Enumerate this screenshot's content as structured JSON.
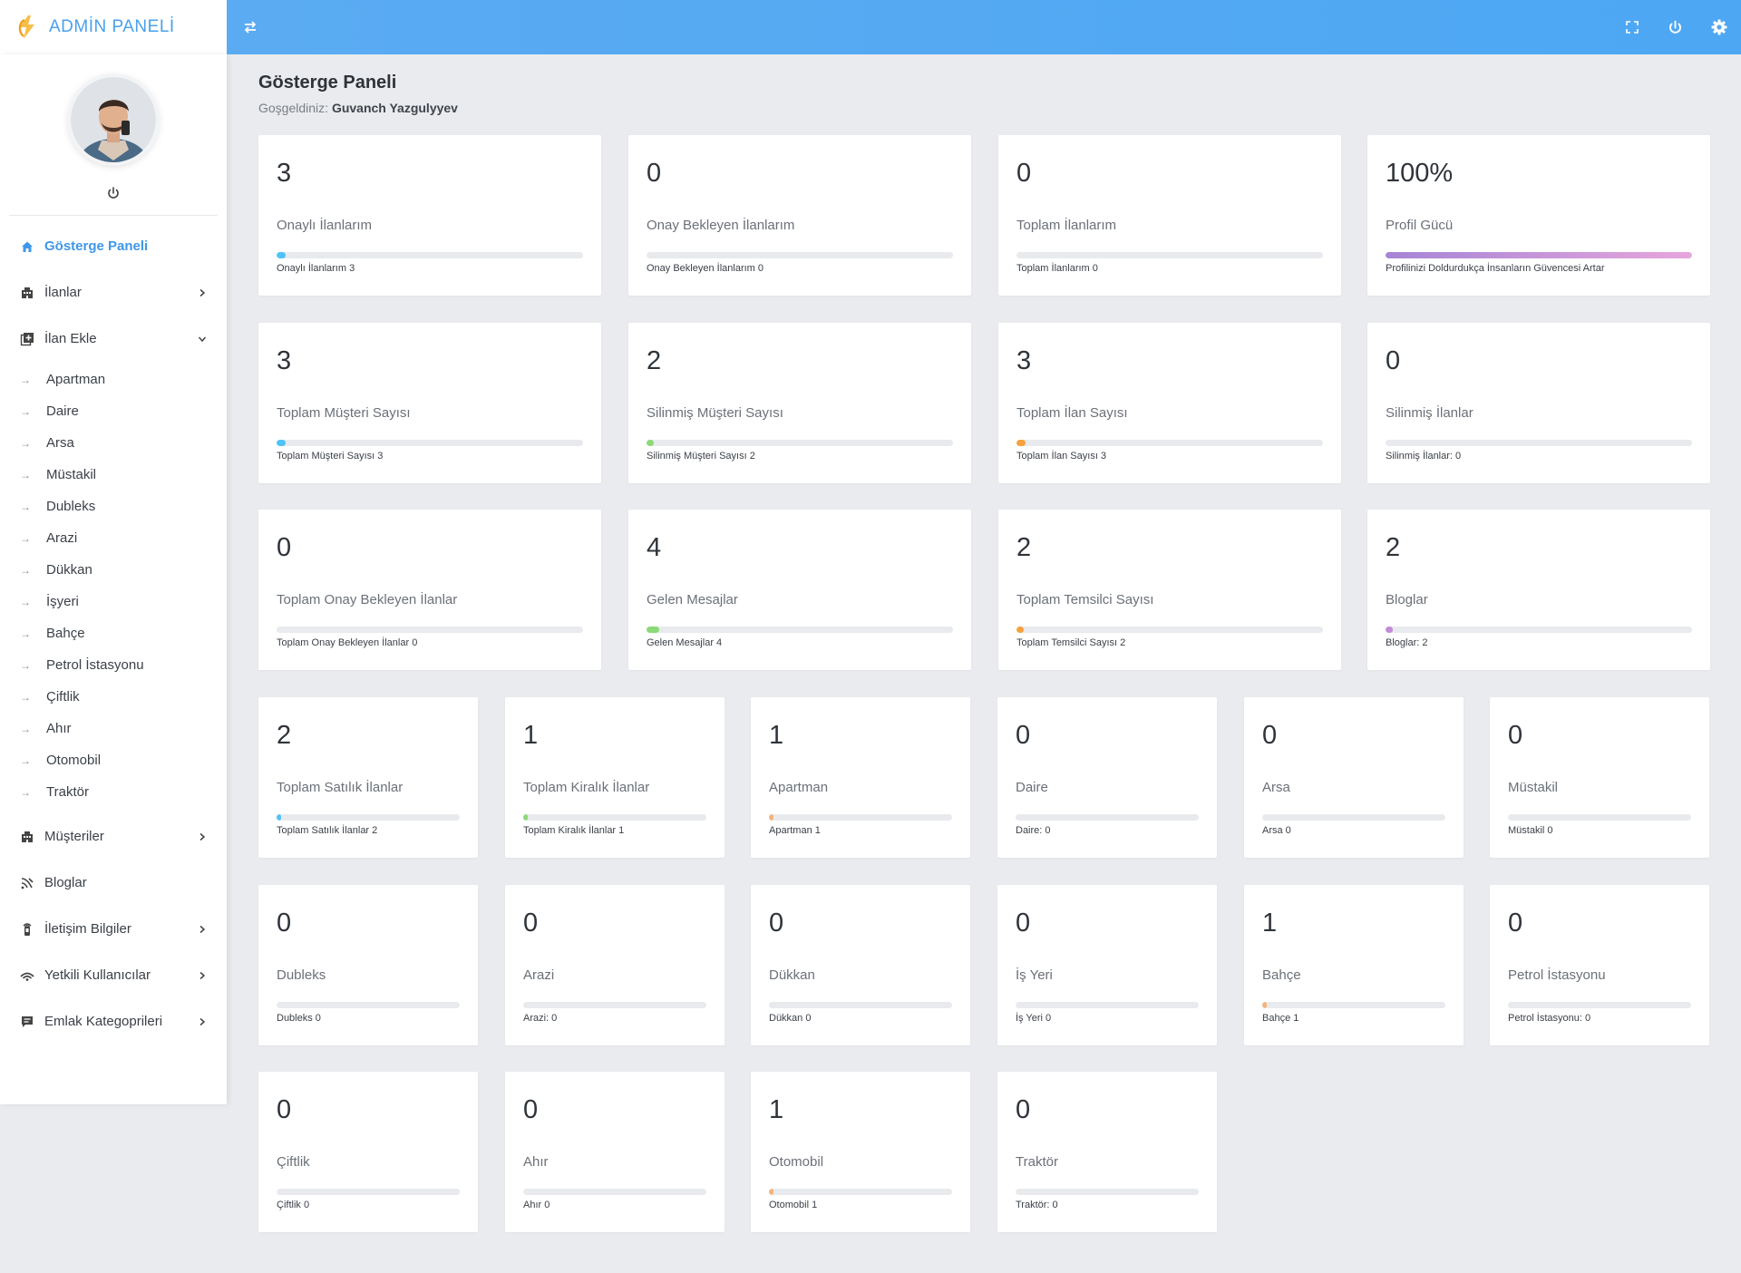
{
  "header": {
    "logo_text": "ADMİN PANELİ"
  },
  "sidebar": {
    "menu": [
      {
        "label": "Gösterge Paneli",
        "icon": "home-icon",
        "active": true
      },
      {
        "label": "İlanlar",
        "icon": "building-icon",
        "chevron": "right"
      },
      {
        "label": "İlan Ekle",
        "icon": "add-listing-icon",
        "chevron": "down"
      }
    ],
    "submenu": [
      "Apartman",
      "Daire",
      "Arsa",
      "Müstakil",
      "Dubleks",
      "Arazi",
      "Dükkan",
      "İşyeri",
      "Bahçe",
      "Petrol İstasyonu",
      "Çiftlik",
      "Ahır",
      "Otomobil",
      "Traktör"
    ],
    "menu_after": [
      {
        "label": "Müşteriler",
        "icon": "building-icon",
        "chevron": "right"
      },
      {
        "label": "Bloglar",
        "icon": "blog-icon"
      },
      {
        "label": "İletişim Bilgiler",
        "icon": "contact-icon",
        "chevron": "right"
      },
      {
        "label": "Yetkili Kullanıcılar",
        "icon": "wifi-icon",
        "chevron": "right"
      },
      {
        "label": "Emlak Kategoprileri",
        "icon": "chat-icon",
        "chevron": "right"
      }
    ]
  },
  "page": {
    "title": "Gösterge Paneli",
    "welcome_prefix": "Goşgeldiniz:",
    "user_name": "Guvanch Yazgulyyev"
  },
  "colors": {
    "blue": "#4fc3f7",
    "green": "#8bd977",
    "orange": "#f6a13d",
    "purple": "#c28bd8",
    "peach": "#f5b47d",
    "gradient": "linear-gradient(90deg,#a585d6,#e7a6dc)"
  },
  "cards": [
    {
      "value": "3",
      "title": "Onaylı İlanlarım",
      "sub": "Onaylı İlanlarım 3",
      "progress": 0.03,
      "color": "blue"
    },
    {
      "value": "0",
      "title": "Onay Bekleyen İlanlarım",
      "sub": "Onay Bekleyen İlanlarım 0",
      "progress": 0.0,
      "color": "blue"
    },
    {
      "value": "0",
      "title": "Toplam İlanlarım",
      "sub": "Toplam İlanlarım 0",
      "progress": 0.0,
      "color": "blue"
    },
    {
      "value": "100%",
      "title": "Profil Gücü",
      "sub": "Profilinizi Doldurdukça İnsanların Güvencesi Artar",
      "progress": 1.0,
      "color": "gradient"
    },
    {
      "value": "3",
      "title": "Toplam Müşteri Sayısı",
      "sub": "Toplam Müşteri Sayısı 3",
      "progress": 0.03,
      "color": "blue"
    },
    {
      "value": "2",
      "title": "Silinmiş Müşteri Sayısı",
      "sub": "Silinmiş Müşteri Sayısı 2",
      "progress": 0.02,
      "color": "green"
    },
    {
      "value": "3",
      "title": "Toplam İlan Sayısı",
      "sub": "Toplam İlan Sayısı 3",
      "progress": 0.03,
      "color": "orange"
    },
    {
      "value": "0",
      "title": "Silinmiş İlanlar",
      "sub": "Silinmiş İlanlar: 0",
      "progress": 0.0,
      "color": "blue"
    },
    {
      "value": "0",
      "title": "Toplam Onay Bekleyen İlanlar",
      "sub": "Toplam Onay Bekleyen İlanlar 0",
      "progress": 0.0,
      "color": "blue"
    },
    {
      "value": "4",
      "title": "Gelen Mesajlar",
      "sub": "Gelen Mesajlar 4",
      "progress": 0.04,
      "color": "green"
    },
    {
      "value": "2",
      "title": "Toplam Temsilci Sayısı",
      "sub": "Toplam Temsilci Sayısı 2",
      "progress": 0.02,
      "color": "orange"
    },
    {
      "value": "2",
      "title": "Bloglar",
      "sub": "Bloglar: 2",
      "progress": 0.02,
      "color": "purple"
    },
    {
      "value": "2",
      "title": "Toplam Satılık İlanlar",
      "sub": "Toplam Satılık İlanlar 2",
      "progress": 0.02,
      "color": "blue"
    },
    {
      "value": "1",
      "title": "Toplam Kiralık İlanlar",
      "sub": "Toplam Kiralık İlanlar 1",
      "progress": 0.01,
      "color": "green"
    },
    {
      "value": "1",
      "title": "Apartman",
      "sub": "Apartman 1",
      "progress": 0.01,
      "color": "peach"
    },
    {
      "value": "0",
      "title": "Daire",
      "sub": "Daire: 0",
      "progress": 0.0,
      "color": "blue"
    },
    {
      "value": "0",
      "title": "Arsa",
      "sub": "Arsa 0",
      "progress": 0.0,
      "color": "blue"
    },
    {
      "value": "0",
      "title": "Müstakil",
      "sub": "Müstakil 0",
      "progress": 0.0,
      "color": "blue"
    },
    {
      "value": "0",
      "title": "Dubleks",
      "sub": "Dubleks 0",
      "progress": 0.0,
      "color": "blue"
    },
    {
      "value": "0",
      "title": "Arazi",
      "sub": "Arazi: 0",
      "progress": 0.0,
      "color": "blue"
    },
    {
      "value": "0",
      "title": "Dükkan",
      "sub": "Dükkan 0",
      "progress": 0.0,
      "color": "blue"
    },
    {
      "value": "0",
      "title": "İş Yeri",
      "sub": "İş Yeri 0",
      "progress": 0.0,
      "color": "blue"
    },
    {
      "value": "1",
      "title": "Bahçe",
      "sub": "Bahçe 1",
      "progress": 0.01,
      "color": "peach"
    },
    {
      "value": "0",
      "title": "Petrol İstasyonu",
      "sub": "Petrol İstasyonu: 0",
      "progress": 0.0,
      "color": "blue"
    },
    {
      "value": "0",
      "title": "Çiftlik",
      "sub": "Çiftlik 0",
      "progress": 0.0,
      "color": "blue"
    },
    {
      "value": "0",
      "title": "Ahır",
      "sub": "Ahır 0",
      "progress": 0.0,
      "color": "blue"
    },
    {
      "value": "1",
      "title": "Otomobil",
      "sub": "Otomobil 1",
      "progress": 0.01,
      "color": "peach"
    },
    {
      "value": "0",
      "title": "Traktör",
      "sub": "Traktör: 0",
      "progress": 0.0,
      "color": "blue"
    }
  ]
}
